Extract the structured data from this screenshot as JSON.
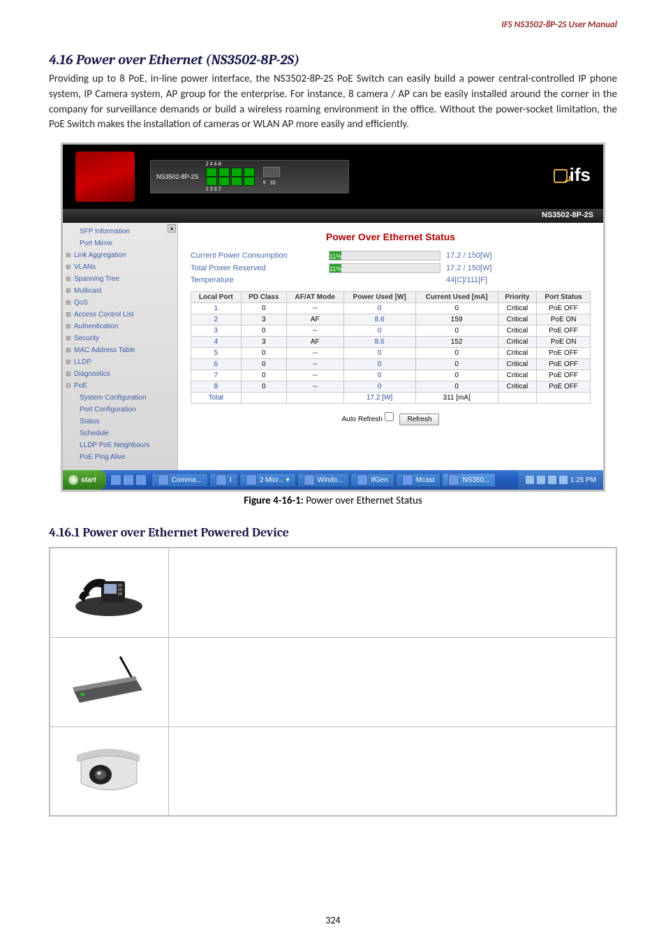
{
  "header": {
    "right": "IFS  NS3502-8P-2S  User Manual"
  },
  "section_title": "4.16 Power over Ethernet (NS3502-8P-2S)",
  "body_para": "Providing up to 8 PoE, in-line power interface, the NS3502-8P-2S PoE Switch can easily build a power central-controlled IP phone system, IP Camera system, AP group for the enterprise. For instance, 8 camera / AP can be easily installed around the corner in the company for surveillance demands or build a wireless roaming environment in the office. Without the power-socket limitation, the PoE Switch makes the installation of cameras or WLAN AP more easily and efficiently.",
  "switch": {
    "model_left": "NS3502-8P-2S",
    "port_top_numbers": [
      "2",
      "4",
      "6",
      "8"
    ],
    "port_bottom_numbers": [
      "1",
      "3",
      "5",
      "7"
    ],
    "sfp_numbers": [
      "9",
      "10"
    ],
    "logo_text": "ifs"
  },
  "model_bar": "NS3502-8P-2S",
  "sidebar": {
    "items": [
      {
        "label": "SFP Information",
        "cls": "sub"
      },
      {
        "label": "Port Mirror",
        "cls": "sub"
      },
      {
        "label": "Link Aggregation",
        "cls": "expand"
      },
      {
        "label": "VLANs",
        "cls": "expand"
      },
      {
        "label": "Spanning Tree",
        "cls": "expand"
      },
      {
        "label": "Multicast",
        "cls": "expand"
      },
      {
        "label": "QoS",
        "cls": "expand"
      },
      {
        "label": "Access Control List",
        "cls": "expand"
      },
      {
        "label": "Authentication",
        "cls": "expand"
      },
      {
        "label": "Security",
        "cls": "expand"
      },
      {
        "label": "MAC Address Table",
        "cls": "expand"
      },
      {
        "label": "LLDP",
        "cls": "expand"
      },
      {
        "label": "Diagnostics",
        "cls": "expand"
      },
      {
        "label": "PoE",
        "cls": "collapse"
      },
      {
        "label": "System Configuration",
        "cls": "sub"
      },
      {
        "label": "Port Configuration",
        "cls": "sub"
      },
      {
        "label": "Status",
        "cls": "sub"
      },
      {
        "label": "Schedule",
        "cls": "sub"
      },
      {
        "label": "LLDP PoE Neighbours",
        "cls": "sub"
      },
      {
        "label": "PoE Ping Alive",
        "cls": "sub"
      }
    ]
  },
  "panel": {
    "title": "Power Over Ethernet Status",
    "rows": [
      {
        "label": "Current Power Consumption",
        "pct": "11%",
        "pct_w": 11,
        "value": "17.2 / 150[W]"
      },
      {
        "label": "Total Power Reserved",
        "pct": "11%",
        "pct_w": 11,
        "value": "17.2 / 150[W]"
      },
      {
        "label": "Temperature",
        "pct": "",
        "pct_w": 0,
        "value": "44[C]/111[F]"
      }
    ],
    "table": {
      "headers": [
        "Local Port",
        "PD Class",
        "AF/AT Mode",
        "Power Used [W]",
        "Current Used [mA]",
        "Priority",
        "Port Status"
      ],
      "rows": [
        {
          "p": "1",
          "c": "0",
          "m": "--",
          "pw": "0",
          "cu": "0",
          "pr": "Critical",
          "st": "PoE OFF"
        },
        {
          "p": "2",
          "c": "3",
          "m": "AF",
          "pw": "8.6",
          "cu": "159",
          "pr": "Critical",
          "st": "PoE ON"
        },
        {
          "p": "3",
          "c": "0",
          "m": "--",
          "pw": "0",
          "cu": "0",
          "pr": "Critical",
          "st": "PoE OFF"
        },
        {
          "p": "4",
          "c": "3",
          "m": "AF",
          "pw": "8.6",
          "cu": "152",
          "pr": "Critical",
          "st": "PoE ON"
        },
        {
          "p": "5",
          "c": "0",
          "m": "--",
          "pw": "0",
          "cu": "0",
          "pr": "Critical",
          "st": "PoE OFF"
        },
        {
          "p": "6",
          "c": "0",
          "m": "--",
          "pw": "0",
          "cu": "0",
          "pr": "Critical",
          "st": "PoE OFF"
        },
        {
          "p": "7",
          "c": "0",
          "m": "--",
          "pw": "0",
          "cu": "0",
          "pr": "Critical",
          "st": "PoE OFF"
        },
        {
          "p": "8",
          "c": "0",
          "m": "--",
          "pw": "0",
          "cu": "0",
          "pr": "Critical",
          "st": "PoE OFF"
        },
        {
          "p": "Total",
          "c": "",
          "m": "",
          "pw": "17.2 [W]",
          "cu": "311 [mA]",
          "pr": "",
          "st": ""
        }
      ]
    },
    "auto_refresh_label": "Auto Refresh",
    "refresh_btn": "Refresh"
  },
  "taskbar": {
    "start": "start",
    "tasks": [
      {
        "label": "Comma..."
      },
      {
        "label": "I"
      },
      {
        "label": "2 Micr...  ▾"
      },
      {
        "label": "Windo..."
      },
      {
        "label": "IfGen"
      },
      {
        "label": "Mcast"
      },
      {
        "label": "NS350..."
      }
    ],
    "time": "1:25 PM"
  },
  "figure_caption_bold": "Figure 4-16-1:",
  "figure_caption_rest": " Power over Ethernet Status",
  "subsection_title": "4.16.1 Power over Ethernet Powered Device",
  "page_number": "324"
}
